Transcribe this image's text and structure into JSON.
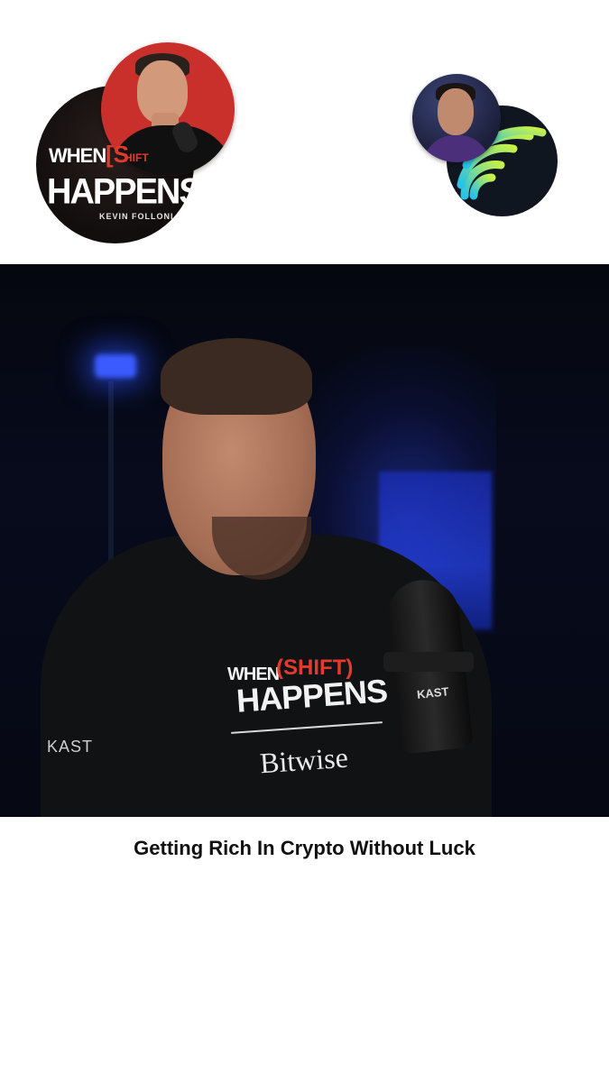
{
  "podcast_badge": {
    "when": "WHEN",
    "bracket": "[S",
    "shift": "HIFT",
    "happens": "HAPPENS",
    "host_name": "KEVIN FOLLONI"
  },
  "video": {
    "shirt_when": "WHEN",
    "shirt_shift": "(SHIFT)",
    "shirt_happens": "HAPPENS",
    "shirt_sponsor": "Bitwise",
    "sleeve_text": "KAST",
    "mic_logo": "KAST"
  },
  "caption": "Getting Rich In Crypto Without Luck",
  "colors": {
    "brand_red": "#e03a2f",
    "background": "#ffffff",
    "studio_blue": "#2540e0"
  }
}
